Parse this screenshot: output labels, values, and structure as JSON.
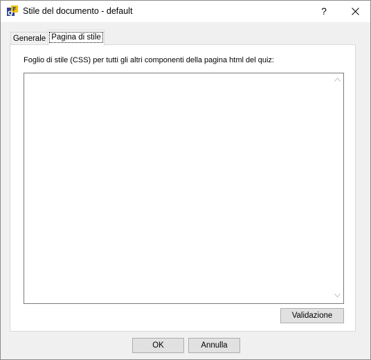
{
  "window": {
    "title": "Stile del documento - default",
    "help_label": "?",
    "app_icon_letters": "QF"
  },
  "tabs": [
    {
      "label": "Generale",
      "selected": false
    },
    {
      "label": "Pagina di stile",
      "selected": true
    }
  ],
  "style_page": {
    "css_label": "Foglio di stile (CSS) per tutti gli altri componenti della pagina html del quiz:",
    "css_value": "",
    "validate_label": "Validazione"
  },
  "footer": {
    "ok_label": "OK",
    "cancel_label": "Annulla"
  }
}
